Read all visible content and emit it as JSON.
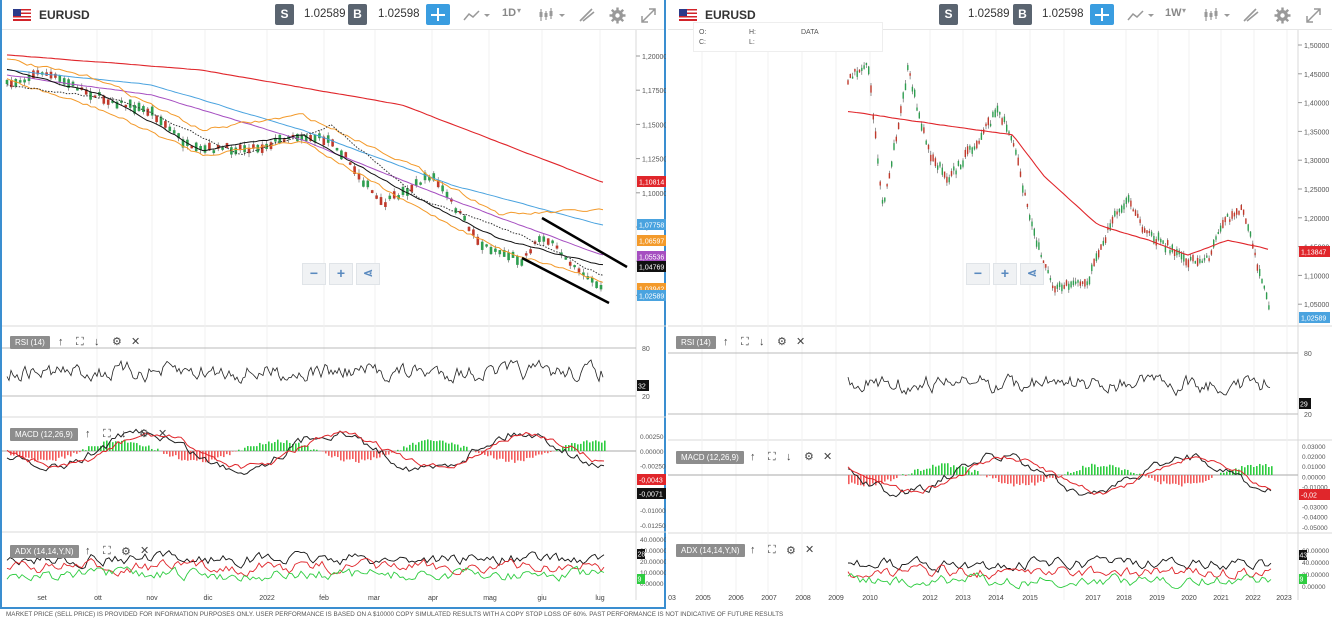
{
  "left": {
    "header": {
      "symbol": "EURUSD",
      "sell_label": "S",
      "sell_price": "1.02589",
      "buy_label": "B",
      "buy_price": "1.02598",
      "period": "1D"
    },
    "price_scale": [
      "1,20000",
      "1,17500",
      "1,15000",
      "1,12500",
      "1,10000",
      "1,07500",
      "1,05000",
      "1,02500"
    ],
    "price_labels": [
      {
        "text": "1,10814",
        "color": "#e0262b"
      },
      {
        "text": "1,07758",
        "color": "#4aa3df"
      },
      {
        "text": "1,06597",
        "color": "#f39a2b"
      },
      {
        "text": "1,05536",
        "color": "#a64fc1"
      },
      {
        "text": "1,04769",
        "color": "#111111"
      },
      {
        "text": "1,03942",
        "color": "#f39a2b"
      },
      {
        "text": "1,02589",
        "color": "#4aa3df"
      }
    ],
    "rsi": {
      "label": "RSI (14)",
      "levels": [
        "80",
        "20"
      ],
      "value": "32"
    },
    "macd": {
      "label": "MACD (12,26,9)",
      "scale": [
        "0.00250",
        "0.00000",
        "-0.00250",
        "-0.00500",
        "-0.00750",
        "-0.01000",
        "-0.01250"
      ],
      "value1": "-0,0043",
      "value2": "-0,0071"
    },
    "adx": {
      "label": "ADX (14,14,Y,N)",
      "scale": [
        "40.00000",
        "30.00000",
        "20.00000",
        "10.00000",
        "0.00000"
      ],
      "v1": "28",
      "v2": "9"
    },
    "x_axis": [
      "set",
      "ott",
      "nov",
      "dic",
      "2022",
      "feb",
      "mar",
      "apr",
      "mag",
      "giu",
      "lug"
    ]
  },
  "right": {
    "header": {
      "symbol": "EURUSD",
      "sell_label": "S",
      "sell_price": "1.02589",
      "buy_label": "B",
      "buy_price": "1.02598",
      "period": "1W"
    },
    "ohlc": {
      "o": "O:",
      "h": "H:",
      "c": "C:",
      "l": "L:",
      "data": "DATA"
    },
    "price_scale": [
      "1,50000",
      "1,45000",
      "1,40000",
      "1,35000",
      "1,30000",
      "1,25000",
      "1,20000",
      "1,15000",
      "1,10000",
      "1,05000"
    ],
    "price_labels": [
      {
        "text": "1,13847",
        "color": "#e0262b"
      },
      {
        "text": "1,02589",
        "color": "#4aa3df"
      }
    ],
    "rsi": {
      "label": "RSI (14)",
      "levels": [
        "80",
        "20"
      ],
      "value": "29"
    },
    "macd": {
      "label": "MACD (12,26,9)",
      "scale": [
        "0.03000",
        "0.02000",
        "0.01000",
        "0.00000",
        "-0.01000",
        "-0.02000",
        "-0.03000",
        "-0.04000",
        "-0.05000"
      ],
      "value": "-0,02"
    },
    "adx": {
      "label": "ADX (14,14,Y,N)",
      "scale": [
        "60.00000",
        "40.00000",
        "20.00000",
        "0.00000"
      ],
      "v1": "43",
      "v2": "9"
    },
    "x_axis": [
      "03",
      "2005",
      "2006",
      "2007",
      "2008",
      "2009",
      "2010",
      "2012",
      "2013",
      "2014",
      "2015",
      "2017",
      "2018",
      "2019",
      "2020",
      "2021",
      "2022",
      "2023"
    ]
  },
  "colors": {
    "accent": "#3a9de0",
    "ma_red": "#e0262b",
    "ma_blue": "#4aa3df",
    "ma_orange": "#f39a2b",
    "ma_purple": "#a64fc1",
    "bull": "#2e9e4f",
    "bear": "#c0392b"
  },
  "footer": "MARKET PRICE (SELL PRICE) IS PROVIDED FOR INFORMATION PURPOSES ONLY. USER PERFORMANCE IS BASED ON A $10000 COPY SIMULATED RESULTS WITH A COPY STOP LOSS OF 60%. PAST PERFORMANCE IS NOT INDICATIVE OF FUTURE RESULTS"
}
